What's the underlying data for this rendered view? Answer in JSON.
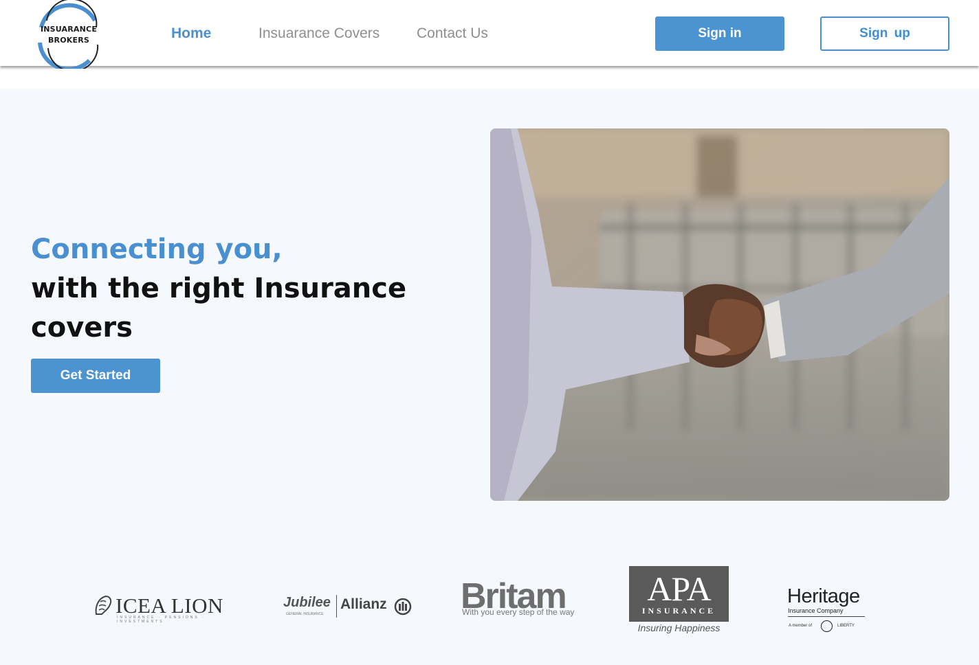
{
  "brand": {
    "line1": "INSUARANCE",
    "line2": "BROKERS"
  },
  "nav": [
    {
      "label": "Home"
    },
    {
      "label": "Insuarance Covers"
    },
    {
      "label": "Contact Us"
    }
  ],
  "auth": {
    "signin": "Sign in",
    "signup": "Sign  up"
  },
  "hero": {
    "accent": "Connecting you,",
    "line2": "with the right Insurance",
    "line3": "covers",
    "cta": "Get Started"
  },
  "partners": {
    "icea": {
      "name": "ICEA LION",
      "tagline": "INSURANCE · PENSIONS · INVESTMENTS"
    },
    "jubilee": {
      "name": "Jubilee",
      "sub": "GENERAL INSURANCE",
      "partner": "Allianz"
    },
    "britam": {
      "name": "Britam",
      "tagline": "With you every step of the way"
    },
    "apa": {
      "name": "APA",
      "sub": "INSURANCE",
      "tagline": "Insuring Happiness"
    },
    "heritage": {
      "name": "Heritage",
      "sub": "Insurance Company",
      "member": "A member of",
      "parent": "LIBERTY"
    }
  },
  "colors": {
    "accent": "#4a90d0",
    "hero_bg": "#f5f8fc",
    "text": "#111111",
    "nav_inactive": "#8f8f8f"
  },
  "icons": [
    "logo-ring",
    "handshake-photo",
    "lion-icon",
    "allianz-icon",
    "liberty-icon"
  ]
}
